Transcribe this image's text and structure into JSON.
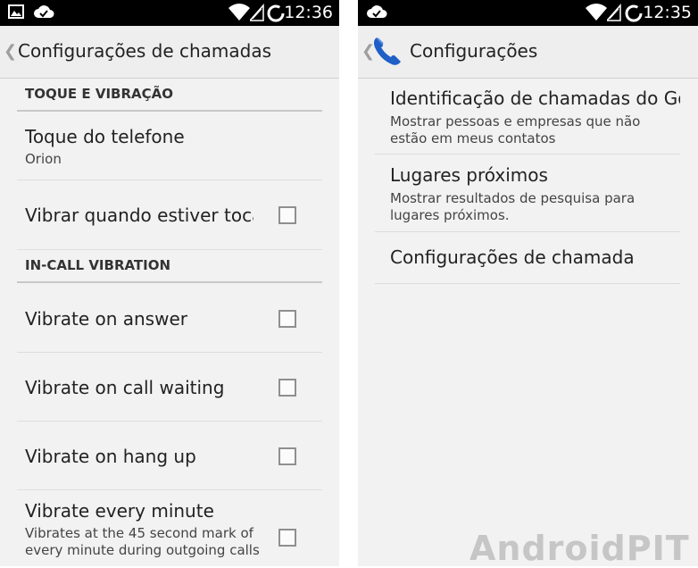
{
  "left": {
    "status_time": "12:36",
    "title": "Configurações de chamadas",
    "sections": [
      {
        "header": "TOQUE E VIBRAÇÃO"
      },
      {
        "header": "IN-CALL VIBRATION"
      }
    ],
    "ringtone": {
      "title": "Toque do telefone",
      "summary": "Orion"
    },
    "vibrate_ringing": {
      "title": "Vibrar quando estiver tocando",
      "checked": false
    },
    "vibrate_answer": {
      "title": "Vibrate on answer",
      "checked": false
    },
    "vibrate_waiting": {
      "title": "Vibrate on call waiting",
      "checked": false
    },
    "vibrate_hangup": {
      "title": "Vibrate on hang up",
      "checked": false
    },
    "vibrate_minute": {
      "title": "Vibrate every minute",
      "summary": "Vibrates at the 45 second mark of every minute during outgoing calls",
      "checked": false
    }
  },
  "right": {
    "status_time": "12:35",
    "title": "Configurações",
    "items": [
      {
        "title": "Identificação de chamadas do Google",
        "summary": "Mostrar pessoas e empresas que não estão em meus contatos"
      },
      {
        "title": "Lugares próximos",
        "summary": "Mostrar resultados de pesquisa para lugares próximos."
      },
      {
        "title": "Configurações de chamada",
        "summary": ""
      }
    ]
  },
  "watermark": "AndroidPIT",
  "colors": {
    "statusbar": "#000000",
    "background": "#f2f2f2",
    "phone_icon": "#1e5fc8"
  },
  "icons": {
    "left_status": [
      "image-icon",
      "cloud-check-icon"
    ],
    "right_status": [
      "cloud-check-icon"
    ],
    "system": [
      "wifi-icon",
      "signal-icon",
      "battery-icon"
    ]
  }
}
